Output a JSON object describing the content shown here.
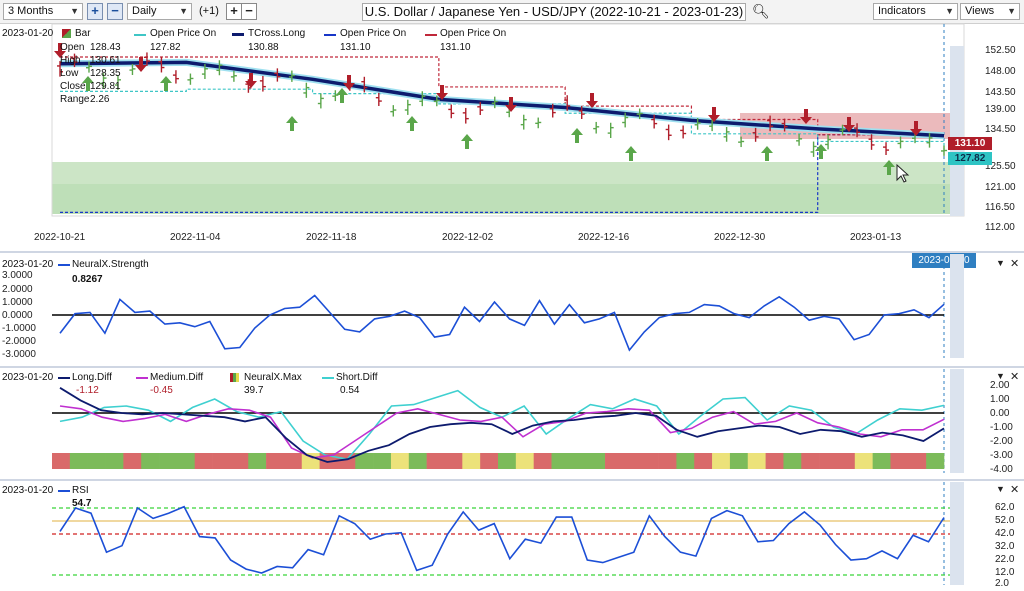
{
  "toolbar": {
    "range": "3 Months",
    "interval": "Daily",
    "shift": "(+1)",
    "title": "U.S. Dollar / Japanese Yen - USD/JPY (2022-10-21 - 2023-01-23)",
    "indicators": "Indicators",
    "views": "Views"
  },
  "main": {
    "date": "2023-01-20",
    "legend": {
      "bar": "Bar",
      "open_label": "Open",
      "open": "128.43",
      "high_label": "High",
      "high": "130.61",
      "low_label": "Low",
      "low": "128.35",
      "close_label": "Close",
      "close": "129.81",
      "range_label": "Range",
      "range": "2.26",
      "opo1_label": "Open Price On",
      "opo1": "127.82",
      "tcross_label": "TCross.Long",
      "tcross": "130.88",
      "opo2_label": "Open Price On",
      "opo2": "131.10",
      "opo3_label": "Open Price On",
      "opo3": "131.10"
    },
    "price_tags": {
      "red": "131.10",
      "cyan": "127.82"
    },
    "y_ticks": [
      "152.50",
      "148.00",
      "143.50",
      "139.00",
      "134.50",
      "130.00",
      "125.50",
      "121.00",
      "116.50",
      "112.00"
    ],
    "x_ticks": [
      "2022-10-21",
      "2022-11-04",
      "2022-11-18",
      "2022-12-02",
      "2022-12-16",
      "2022-12-30",
      "2023-01-13"
    ],
    "x_selected": "2023-01-20",
    "colors": {
      "tcross": "#0d1b6e",
      "bull": "#5aa64a",
      "bear": "#b01e2a",
      "opo_cyan": "#3fc6c6",
      "opo_red": "#c0283a",
      "opo_blue": "#1836c8"
    }
  },
  "neural": {
    "date": "2023-01-20",
    "name": "NeuralX.Strength",
    "value": "0.8267",
    "y_ticks": [
      "3.0000",
      "2.0000",
      "1.0000",
      "0.0000",
      "-1.0000",
      "-2.0000",
      "-3.0000"
    ]
  },
  "diff": {
    "date": "2023-01-20",
    "long_label": "Long.Diff",
    "long": "-1.12",
    "medium_label": "Medium.Diff",
    "medium": "-0.45",
    "max_label": "NeuralX.Max",
    "max": "39.7",
    "short_label": "Short.Diff",
    "short": "0.54",
    "y_ticks": [
      "2.00",
      "1.00",
      "0.00",
      "-1.00",
      "-2.00",
      "-3.00",
      "-4.00"
    ]
  },
  "rsi": {
    "date": "2023-01-20",
    "name": "RSI",
    "value": "54.7",
    "y_ticks": [
      "62.0",
      "52.0",
      "42.0",
      "32.0",
      "22.0",
      "12.0",
      "2.0"
    ]
  },
  "chart_data": [
    {
      "type": "line",
      "title": "U.S. Dollar / Japanese Yen - USD/JPY (2022-10-21 - 2023-01-23)",
      "ylim": [
        112,
        155
      ],
      "x": [
        "2022-10-21",
        "2022-11-04",
        "2022-11-18",
        "2022-12-02",
        "2022-12-16",
        "2022-12-30",
        "2023-01-13",
        "2023-01-20"
      ],
      "series": [
        {
          "name": "TCross.Long",
          "values": [
            147.0,
            147.3,
            143.5,
            139.0,
            137.2,
            134.3,
            132.4,
            130.88
          ]
        },
        {
          "name": "Open Price On",
          "values": [
            140.8,
            141.3,
            140.3,
            138.0,
            135.9,
            131.3,
            129.6,
            127.82
          ]
        },
        {
          "name": "Open Price On",
          "values": [
            148.5,
            148.5,
            148.5,
            141.8,
            137.5,
            134.5,
            131.1,
            131.1
          ]
        },
        {
          "name": "Open Price On",
          "values": [
            113.7,
            113.7,
            113.7,
            113.7,
            113.7,
            113.7,
            131.1,
            131.1
          ]
        }
      ]
    },
    {
      "type": "line",
      "title": "NeuralX.Strength",
      "ylim": [
        -3.5,
        3.5
      ],
      "series": [
        {
          "name": "NeuralX.Strength",
          "values": [
            -1.4,
            0.1,
            0.2,
            -1.4,
            1.2,
            0.2,
            0.3,
            -0.7,
            -0.6,
            -0.9,
            -0.5,
            -2.6,
            -2.5,
            -1.0,
            0.0,
            0.5,
            0.6,
            1.5,
            0.2,
            -1.1,
            -1.3,
            -0.3,
            -0.1,
            0.3,
            -0.2,
            -1.7,
            -1.5,
            0.6,
            -0.5,
            1.0,
            -0.3,
            -0.8,
            1.1,
            -0.7,
            0.8,
            -0.6,
            -0.3,
            0.2,
            -2.7,
            -1.3,
            -0.2,
            0.1,
            0.2,
            0.8,
            0.7,
            0.1,
            -0.2,
            0.7,
            1.4,
            0.6,
            -0.4,
            -0.1,
            -0.3,
            -1.9,
            -1.5,
            0.0,
            0.1,
            0.4,
            -0.2,
            0.8267
          ]
        }
      ]
    },
    {
      "type": "line",
      "title": "Diff",
      "ylim": [
        -4,
        2
      ],
      "series": [
        {
          "name": "Long.Diff",
          "values": [
            1.8,
            0.9,
            0.2,
            0.0,
            -0.1,
            0.0,
            -0.1,
            -0.2,
            -0.3,
            -0.6,
            -0.3,
            -1.8,
            -3.0,
            -3.5,
            -3.3,
            -2.7,
            -2.3,
            -1.5,
            -1.0,
            -0.8,
            -0.7,
            -0.8,
            -1.5,
            -0.9,
            -0.6,
            -0.5,
            -0.3,
            -0.2,
            0.0,
            -0.2,
            -1.2,
            -1.7,
            -1.3,
            -1.1,
            -0.9,
            -1.0,
            -1.5,
            -1.2,
            -1.3,
            -1.7,
            -1.4,
            -1.6,
            -2.0,
            -1.1
          ]
        },
        {
          "name": "Medium.Diff",
          "values": [
            0.5,
            0.3,
            -0.3,
            -0.6,
            -0.4,
            -0.1,
            -0.6,
            -0.1,
            0.3,
            0.2,
            -0.3,
            -2.5,
            -3.2,
            -3.0,
            -2.0,
            -1.0,
            0.0,
            0.3,
            -0.1,
            -0.5,
            -0.6,
            -0.3,
            -1.7,
            -0.8,
            -0.6,
            0.0,
            0.1,
            0.3,
            0.2,
            -1.4,
            -1.1,
            -0.3,
            0.1,
            -0.8,
            -0.6,
            0.0,
            -0.7,
            -1.0,
            -1.5,
            -1.7,
            -1.2,
            -1.2,
            -0.45
          ]
        },
        {
          "name": "Short.Diff",
          "values": [
            -0.6,
            -0.3,
            0.4,
            0.5,
            0.2,
            -0.6,
            0.4,
            1.0,
            0.1,
            -0.3,
            0.1,
            -2.0,
            -3.0,
            -3.3,
            -1.5,
            0.5,
            0.6,
            1.1,
            1.6,
            0.4,
            -0.3,
            0.5,
            -1.5,
            -0.4,
            0.6,
            0.3,
            1.0,
            0.5,
            -1.5,
            -0.2,
            1.0,
            1.1,
            -0.5,
            0.5,
            0.2,
            -1.0,
            -1.5,
            -0.5,
            0.3,
            0.2,
            0.54
          ]
        }
      ]
    },
    {
      "type": "line",
      "title": "RSI",
      "ylim": [
        2,
        67
      ],
      "series": [
        {
          "name": "RSI",
          "values": [
            44,
            62,
            58,
            28,
            33,
            62,
            54,
            58,
            63,
            40,
            39,
            22,
            15,
            12,
            17,
            16,
            30,
            26,
            56,
            50,
            38,
            42,
            43,
            14,
            18,
            42,
            59,
            45,
            50,
            23,
            38,
            35,
            55,
            55,
            22,
            20,
            24,
            28,
            56,
            40,
            28,
            25,
            54,
            60,
            56,
            36,
            37,
            50,
            59,
            49,
            34,
            22,
            23,
            29,
            23,
            41,
            36,
            54.7
          ]
        }
      ]
    }
  ]
}
